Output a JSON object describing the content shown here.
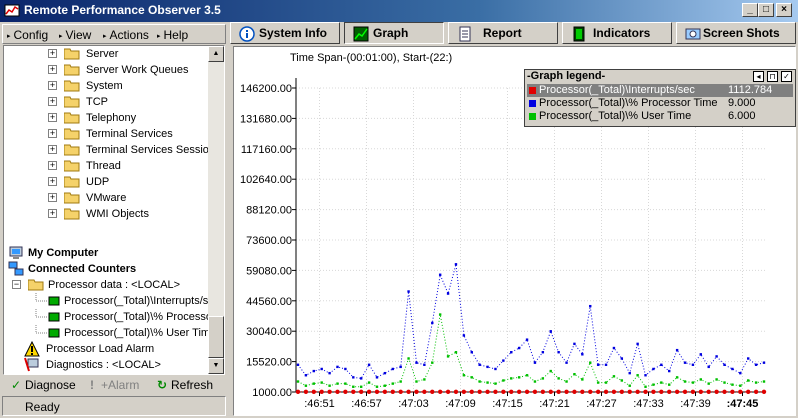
{
  "window": {
    "title": "Remote Performance Observer 3.5",
    "controls": [
      "_",
      "□",
      "×"
    ]
  },
  "menu": [
    {
      "label": "Config"
    },
    {
      "label": "View"
    },
    {
      "label": "Actions"
    },
    {
      "label": "Help"
    }
  ],
  "tree": {
    "items": [
      {
        "label": "Server",
        "type": "folder"
      },
      {
        "label": "Server Work Queues",
        "type": "folder"
      },
      {
        "label": "System",
        "type": "folder"
      },
      {
        "label": "TCP",
        "type": "folder"
      },
      {
        "label": "Telephony",
        "type": "folder"
      },
      {
        "label": "Terminal Services",
        "type": "folder"
      },
      {
        "label": "Terminal Services Session",
        "type": "folder"
      },
      {
        "label": "Thread",
        "type": "folder"
      },
      {
        "label": "UDP",
        "type": "folder"
      },
      {
        "label": "VMware",
        "type": "folder"
      },
      {
        "label": "WMI Objects",
        "type": "folder"
      }
    ],
    "my_computer": "My Computer",
    "connected_counters": "Connected Counters",
    "processor_data": "Processor data : <LOCAL>",
    "counters": [
      "Processor(_Total)\\Interrupts/sec",
      "Processor(_Total)\\% Processor Time",
      "Processor(_Total)\\% User Time"
    ],
    "alarm": "Processor Load Alarm",
    "diagnostics": "Diagnostics : <LOCAL>"
  },
  "bottom_buttons": {
    "diagnose": "Diagnose",
    "alarm": "+Alarm",
    "refresh": "Refresh"
  },
  "status": "Ready",
  "tabs": [
    {
      "label": "System Info",
      "active": false,
      "icon": "info-icon"
    },
    {
      "label": "Graph",
      "active": true,
      "icon": "graph-icon"
    },
    {
      "label": "Report",
      "active": false,
      "icon": "report-icon"
    },
    {
      "label": "Indicators",
      "active": false,
      "icon": "indicator-icon"
    },
    {
      "label": "Screen Shots",
      "active": false,
      "icon": "screenshot-icon"
    }
  ],
  "graph": {
    "timespan": "Time Span-(00:01:00), Start-(22:)"
  },
  "legend": {
    "title": "-Graph legend-",
    "entries": [
      {
        "name": "Processor(_Total)\\Interrupts/sec",
        "value": "1112.784",
        "color": "#e00000",
        "selected": true
      },
      {
        "name": "Processor(_Total)\\% Processor Time",
        "value": "9.000",
        "color": "#0000e0",
        "selected": false
      },
      {
        "name": "Processor(_Total)\\% User Time",
        "value": "6.000",
        "color": "#00c000",
        "selected": false
      }
    ]
  },
  "chart_data": {
    "type": "line",
    "title": "",
    "xlabel": "",
    "ylabel": "",
    "ylim": [
      1000,
      146200
    ],
    "yticks": [
      146200,
      131680,
      117160,
      102640,
      88120,
      73600,
      59080,
      44560,
      30040,
      15520,
      1000
    ],
    "ytick_labels": [
      "146200.00",
      "131680.00",
      "117160.00",
      "102640.00",
      "88120.00",
      "73600.00",
      "59080.00",
      "44560.00",
      "30040.00",
      "15520.00",
      "1000.00"
    ],
    "xtick_labels": [
      ":46:51",
      ":46:57",
      ":47:03",
      ":47:09",
      ":47:15",
      ":47:21",
      ":47:27",
      ":47:33",
      ":47:39",
      ":47:45"
    ],
    "x_start": ":46:48",
    "x_end": ":47:48",
    "grid": true,
    "series": [
      {
        "name": "Processor(_Total)\\Interrupts/sec",
        "color": "#e00000",
        "values": [
          1100,
          1100,
          1100,
          1100,
          1100,
          1100,
          1100,
          1100,
          1100,
          1100,
          1100,
          1100,
          1100,
          1100,
          1100,
          1100,
          1100,
          1100,
          1100,
          1100,
          1100,
          1100,
          1100,
          1100,
          1100,
          1100,
          1100,
          1100,
          1100,
          1100,
          1100,
          1100,
          1100,
          1100,
          1100,
          1100,
          1100,
          1100,
          1100,
          1100,
          1100,
          1100,
          1100,
          1100,
          1100,
          1100,
          1100,
          1100,
          1100,
          1100,
          1100,
          1100,
          1100,
          1100,
          1100,
          1100,
          1100,
          1100,
          1100,
          1113
        ]
      },
      {
        "name": "Processor(_Total)\\% Processor Time",
        "color": "#0000e0",
        "values": [
          14000,
          9000,
          11000,
          12000,
          10000,
          13000,
          12000,
          8000,
          7500,
          14000,
          8000,
          10000,
          12000,
          13000,
          49000,
          15000,
          14000,
          34000,
          57000,
          48000,
          62000,
          28000,
          20000,
          14000,
          13000,
          12000,
          16000,
          20000,
          22000,
          26000,
          15000,
          20000,
          30000,
          20000,
          15000,
          24000,
          19000,
          42000,
          14000,
          14000,
          22000,
          17000,
          10000,
          24000,
          9000,
          12000,
          14000,
          11000,
          21000,
          15000,
          14000,
          19000,
          13000,
          18000,
          14000,
          12000,
          10000,
          17000,
          14000,
          15000
        ]
      },
      {
        "name": "Processor(_Total)\\% User Time",
        "color": "#00c000",
        "values": [
          6000,
          4000,
          5000,
          5500,
          4000,
          5000,
          5000,
          3500,
          3500,
          5500,
          3500,
          4000,
          5000,
          6000,
          17000,
          6000,
          7000,
          15000,
          38000,
          18000,
          20000,
          9000,
          8000,
          6000,
          5500,
          5000,
          6500,
          7500,
          8000,
          9000,
          6000,
          7500,
          11000,
          7500,
          6000,
          9500,
          7000,
          15000,
          5500,
          5500,
          8500,
          6500,
          4000,
          9000,
          3500,
          4500,
          5500,
          4500,
          8000,
          6000,
          5500,
          7000,
          5000,
          7000,
          5500,
          4500,
          4000,
          6500,
          5500,
          6000
        ]
      }
    ]
  }
}
